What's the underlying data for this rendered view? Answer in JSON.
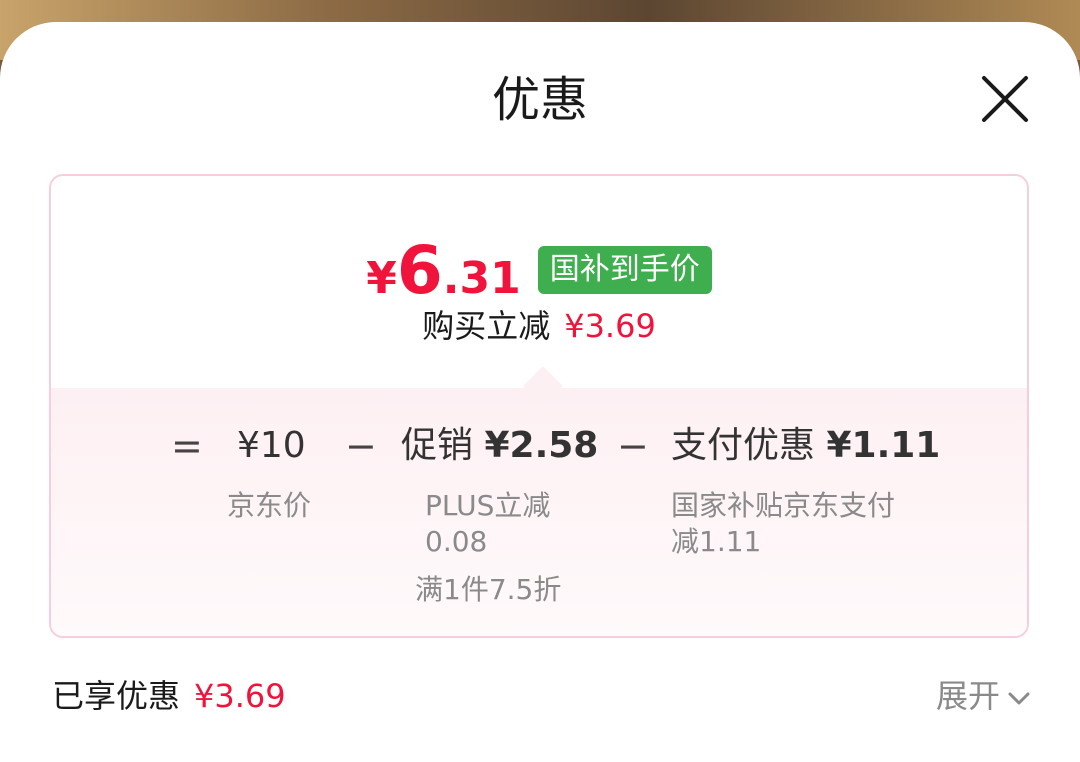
{
  "sheet": {
    "title": "优惠",
    "close_icon": "close-icon"
  },
  "price_card": {
    "final_price_symbol": "¥",
    "final_price_int": "6",
    "final_price_dec": ".31",
    "price_badge": "国补到手价",
    "save_label": "购买立减",
    "save_amount": "¥3.69"
  },
  "breakdown": {
    "equals": "=",
    "minus": "−",
    "base": {
      "amount": "¥10",
      "desc": "京东价"
    },
    "promo": {
      "label": "促销",
      "amount": "¥2.58",
      "desc_line1": "PLUS立减",
      "desc_line2": "0.08",
      "desc_line3": "满1件7.5折"
    },
    "payment": {
      "label": "支付优惠",
      "amount": "¥1.11",
      "desc_line1": "国家补贴京东支付",
      "desc_line2": "减1.11"
    }
  },
  "footer": {
    "enjoyed_label": "已享优惠",
    "enjoyed_amount": "¥3.69",
    "expand_label": "展开",
    "expand_icon": "chevron-down-icon"
  },
  "colors": {
    "accent_red": "#f0143c",
    "badge_green": "#3fae4e",
    "card_border": "#f7cfdc"
  }
}
